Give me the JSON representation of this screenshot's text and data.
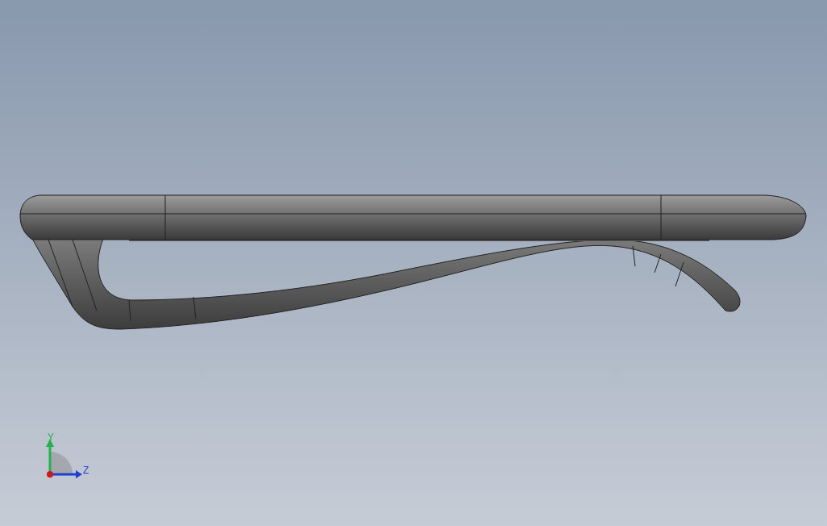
{
  "triad": {
    "axes": [
      {
        "label": "Y",
        "kind": "y",
        "color": "#22b14c"
      },
      {
        "label": "Z",
        "kind": "z",
        "color": "#1f3fd0"
      }
    ]
  }
}
